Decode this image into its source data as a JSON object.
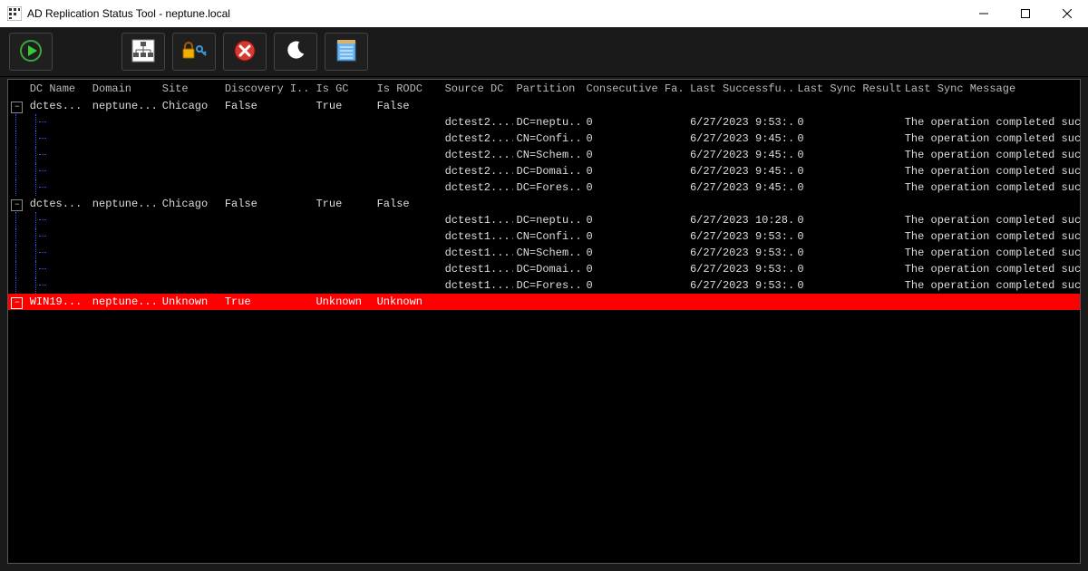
{
  "window": {
    "title": "AD Replication Status Tool - neptune.local"
  },
  "toolbar": {
    "run": "run-icon",
    "forest": "forest-icon",
    "lock": "lock-icon",
    "error": "error-icon",
    "night": "night-icon",
    "note": "note-icon"
  },
  "columns": {
    "dcname": "DC Name",
    "domain": "Domain",
    "site": "Site",
    "discovery": "Discovery I...",
    "isgc": "Is GC",
    "isrodc": "Is RODC",
    "sourcedc": "Source DC",
    "partition": "Partition",
    "consec": "Consecutive Fa...",
    "lastsucc": "Last Successfu...",
    "lastres": "Last Sync Result",
    "lastmsg": "Last Sync Message"
  },
  "groups": [
    {
      "dcname": "dctes...",
      "domain": "neptune....",
      "site": "Chicago",
      "discovery": "False",
      "isgc": "True",
      "isrodc": "False",
      "error": false,
      "rows": [
        {
          "src": "dctest2....",
          "part": "DC=neptu...",
          "cf": "0",
          "ls": "6/27/2023 9:53:...",
          "lr": "0",
          "lm": "The operation completed succ..."
        },
        {
          "src": "dctest2....",
          "part": "CN=Confi...",
          "cf": "0",
          "ls": "6/27/2023 9:45:...",
          "lr": "0",
          "lm": "The operation completed succ..."
        },
        {
          "src": "dctest2....",
          "part": "CN=Schem...",
          "cf": "0",
          "ls": "6/27/2023 9:45:...",
          "lr": "0",
          "lm": "The operation completed succ..."
        },
        {
          "src": "dctest2....",
          "part": "DC=Domai...",
          "cf": "0",
          "ls": "6/27/2023 9:45:...",
          "lr": "0",
          "lm": "The operation completed succ..."
        },
        {
          "src": "dctest2....",
          "part": "DC=Fores...",
          "cf": "0",
          "ls": "6/27/2023 9:45:...",
          "lr": "0",
          "lm": "The operation completed succ..."
        }
      ]
    },
    {
      "dcname": "dctes...",
      "domain": "neptune....",
      "site": "Chicago",
      "discovery": "False",
      "isgc": "True",
      "isrodc": "False",
      "error": false,
      "rows": [
        {
          "src": "dctest1....",
          "part": "DC=neptu...",
          "cf": "0",
          "ls": "6/27/2023 10:28...",
          "lr": "0",
          "lm": "The operation completed succ..."
        },
        {
          "src": "dctest1....",
          "part": "CN=Confi...",
          "cf": "0",
          "ls": "6/27/2023 9:53:...",
          "lr": "0",
          "lm": "The operation completed succ..."
        },
        {
          "src": "dctest1....",
          "part": "CN=Schem...",
          "cf": "0",
          "ls": "6/27/2023 9:53:...",
          "lr": "0",
          "lm": "The operation completed succ..."
        },
        {
          "src": "dctest1....",
          "part": "DC=Domai...",
          "cf": "0",
          "ls": "6/27/2023 9:53:...",
          "lr": "0",
          "lm": "The operation completed succ..."
        },
        {
          "src": "dctest1....",
          "part": "DC=Fores...",
          "cf": "0",
          "ls": "6/27/2023 9:53:...",
          "lr": "0",
          "lm": "The operation completed succ..."
        }
      ]
    },
    {
      "dcname": "WIN19...",
      "domain": "neptune....",
      "site": "Unknown",
      "discovery": "True",
      "isgc": "Unknown",
      "isrodc": "Unknown",
      "error": true,
      "rows": []
    }
  ]
}
